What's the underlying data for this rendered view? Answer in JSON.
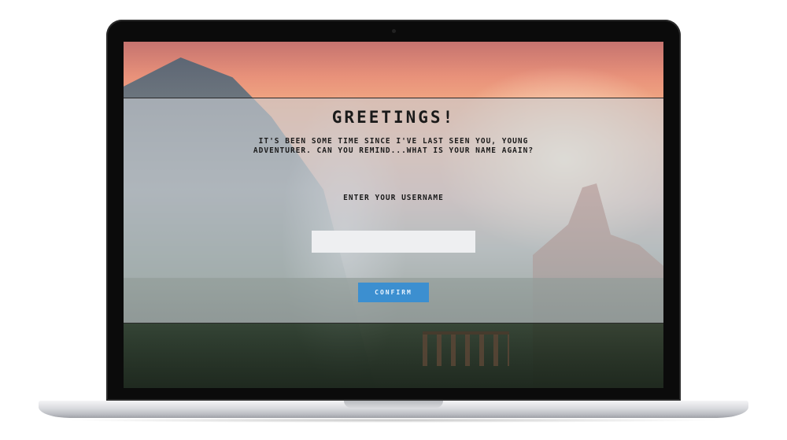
{
  "dialog": {
    "title": "GREETINGS!",
    "message": "IT'S BEEN SOME TIME SINCE I'VE LAST SEEN YOU, YOUNG ADVENTURER. CAN YOU REMIND...WHAT IS YOUR NAME AGAIN?",
    "input_label": "ENTER YOUR USERNAME",
    "username_value": "",
    "confirm_label": "CONFIRM"
  },
  "colors": {
    "button": "#3c8fd0",
    "overlay": "#c8cdd4",
    "text": "#1a1a1a"
  }
}
